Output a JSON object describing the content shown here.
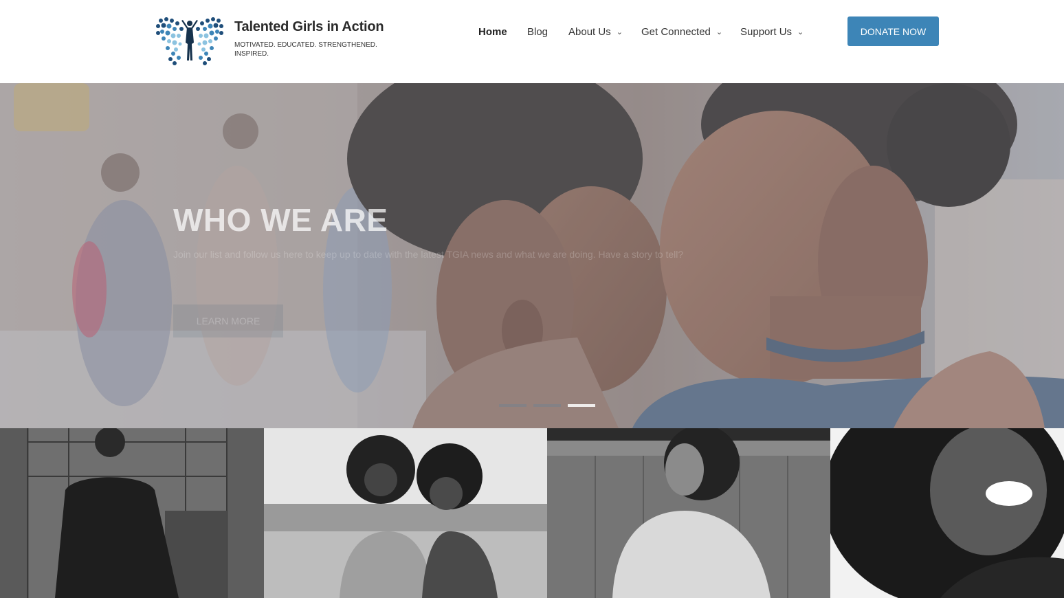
{
  "brand": {
    "name": "Talented Girls in Action",
    "tagline": "MOTIVATED. EDUCATED. STRENGTHENED. INSPIRED.",
    "logo_icon": "butterfly-logo-icon",
    "colors": {
      "dark": "#1f4e7a",
      "mid": "#3d85b7",
      "light": "#8cc3e0"
    }
  },
  "nav": {
    "items": [
      {
        "label": "Home",
        "active": true,
        "dropdown": false
      },
      {
        "label": "Blog",
        "active": false,
        "dropdown": false
      },
      {
        "label": "About Us",
        "active": false,
        "dropdown": true
      },
      {
        "label": "Get Connected",
        "active": false,
        "dropdown": true
      },
      {
        "label": "Support Us",
        "active": false,
        "dropdown": true
      }
    ],
    "chevron_icon": "chevron-down-icon",
    "chevron_glyph": "⌄"
  },
  "donate": {
    "label": "DONATE NOW",
    "color": "#3d85b7"
  },
  "hero": {
    "title": "WHO WE ARE",
    "subtitle": "Join our list and follow us here to keep up to date with the latest TGIA news and what we are doing. Have a story to tell?",
    "button_label": "LEARN MORE",
    "slides": 3,
    "active_slide": 3
  },
  "gallery": {
    "photos": [
      "gallery-photo-1",
      "gallery-photo-2",
      "gallery-photo-3",
      "gallery-photo-4"
    ]
  }
}
